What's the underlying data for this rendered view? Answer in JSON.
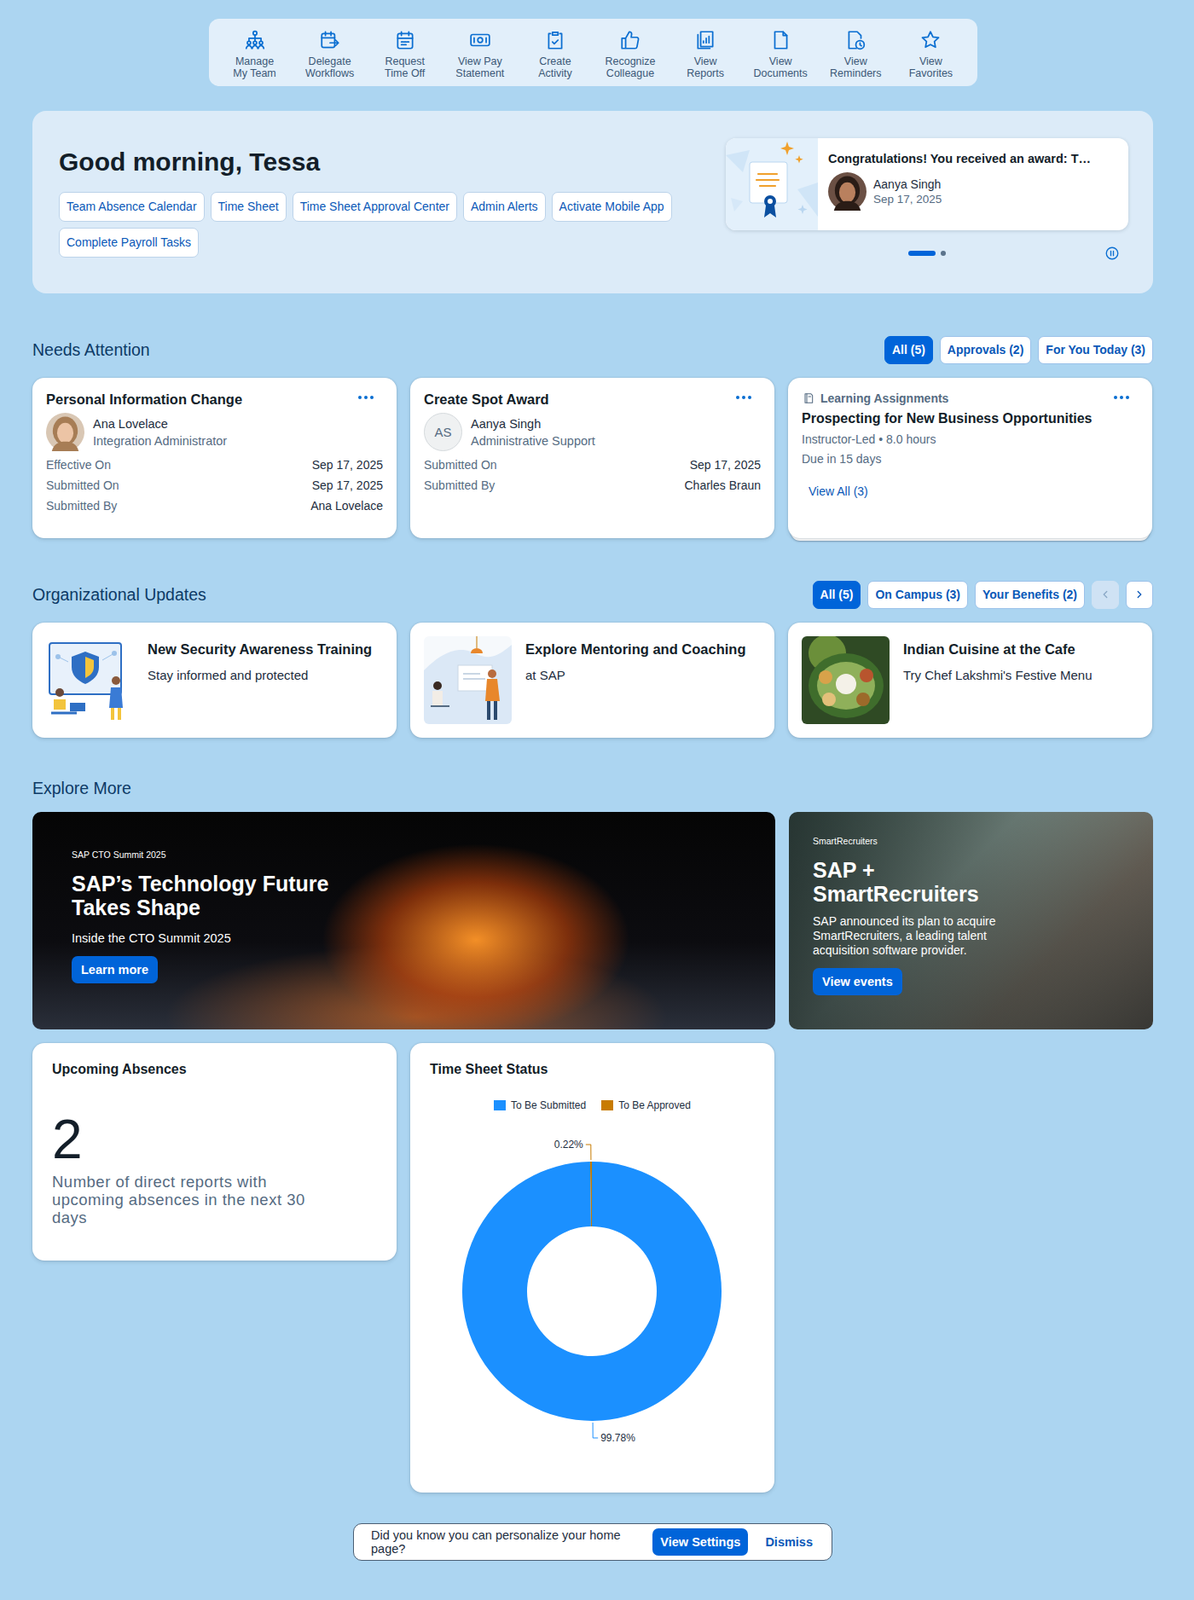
{
  "toolbar": [
    {
      "lines": [
        "Manage",
        "My Team"
      ]
    },
    {
      "lines": [
        "Delegate",
        "Workflows"
      ]
    },
    {
      "lines": [
        "Request",
        "Time Off"
      ]
    },
    {
      "lines": [
        "View Pay",
        "Statement"
      ]
    },
    {
      "lines": [
        "Create",
        "Activity"
      ]
    },
    {
      "lines": [
        "Recognize",
        "Colleague"
      ]
    },
    {
      "lines": [
        "View",
        "Reports"
      ]
    },
    {
      "lines": [
        "View",
        "Documents"
      ]
    },
    {
      "lines": [
        "View",
        "Reminders"
      ]
    },
    {
      "lines": [
        "View",
        "Favorites"
      ]
    }
  ],
  "hero": {
    "greeting": "Good morning, Tessa",
    "links": [
      "Team Absence Calendar",
      "Time Sheet",
      "Time Sheet Approval Center",
      "Admin Alerts",
      "Activate Mobile App",
      "Complete Payroll Tasks"
    ],
    "award": {
      "title": "Congratulations! You received an award: T…",
      "name": "Aanya Singh",
      "date": "Sep 17, 2025"
    },
    "carousel": [
      {
        "selected": true
      },
      {
        "selected": false
      }
    ]
  },
  "needs_attention": {
    "title": "Needs Attention",
    "filters": [
      {
        "label": "All (5)",
        "selected": true
      },
      {
        "label": "Approvals (2)",
        "selected": false
      },
      {
        "label": "For You Today (3)",
        "selected": false
      }
    ],
    "cards": [
      {
        "kind": "request",
        "title": "Personal Information Change",
        "avatar": "photo",
        "name": "Ana Lovelace",
        "role": "Integration Administrator",
        "fields": [
          {
            "label": "Effective On",
            "value": "Sep 17, 2025"
          },
          {
            "label": "Submitted On",
            "value": "Sep 17, 2025"
          },
          {
            "label": "Submitted By",
            "value": "Ana Lovelace"
          }
        ]
      },
      {
        "kind": "request",
        "title": "Create Spot Award",
        "avatar": "initials",
        "initials": "AS",
        "name": "Aanya Singh",
        "role": "Administrative Support",
        "fields": [
          {
            "label": "Submitted On",
            "value": "Sep 17, 2025"
          },
          {
            "label": "Submitted By",
            "value": "Charles Braun"
          }
        ]
      },
      {
        "kind": "learning",
        "category": "Learning Assignments",
        "title": "Prospecting for New Business Opportunities",
        "meta": "Instructor-Led • 8.0 hours",
        "due": "Due in 15 days",
        "link": "View All (3)"
      }
    ]
  },
  "org_updates": {
    "title": "Organizational Updates",
    "filters": [
      {
        "label": "All (5)",
        "selected": true
      },
      {
        "label": "On Campus (3)",
        "selected": false
      },
      {
        "label": "Your Benefits (2)",
        "selected": false
      }
    ],
    "pager": {
      "prev_disabled": true,
      "next_disabled": false
    },
    "cards": [
      {
        "title": "New Security Awareness Training",
        "subtitle": "Stay informed and protected"
      },
      {
        "title": "Explore Mentoring and Coaching",
        "subtitle": "at SAP"
      },
      {
        "title": "Indian Cuisine at the Cafe",
        "subtitle": "Try Chef Lakshmi's Festive Menu"
      }
    ]
  },
  "explore_more": {
    "title": "Explore More",
    "banners": [
      {
        "eyebrow": "SAP CTO Summit 2025",
        "title": "SAP’s Technology Future Takes Shape",
        "subtitle": "Inside the CTO Summit 2025",
        "button": "Learn more"
      },
      {
        "eyebrow": "SmartRecruiters",
        "title": "SAP + SmartRecruiters",
        "subtitle": "SAP announced its plan to acquire SmartRecruiters, a leading talent acquisition software provider.",
        "button": "View events"
      }
    ]
  },
  "upcoming_absences": {
    "title": "Upcoming Absences",
    "value": "2",
    "caption": "Number of direct reports with upcoming absences in the next 30 days"
  },
  "time_sheet_status": {
    "title": "Time Sheet Status",
    "series": [
      {
        "name": "To Be Submitted",
        "color": "#1b90ff",
        "values": [
          99.78
        ],
        "label": "99.78%"
      },
      {
        "name": "To Be Approved",
        "color": "#c87b00",
        "values": [
          0.22
        ],
        "label": "0.22%"
      }
    ]
  },
  "toast": {
    "text": "Did you know you can personalize your home page?",
    "primary": "View Settings",
    "secondary": "Dismiss"
  }
}
